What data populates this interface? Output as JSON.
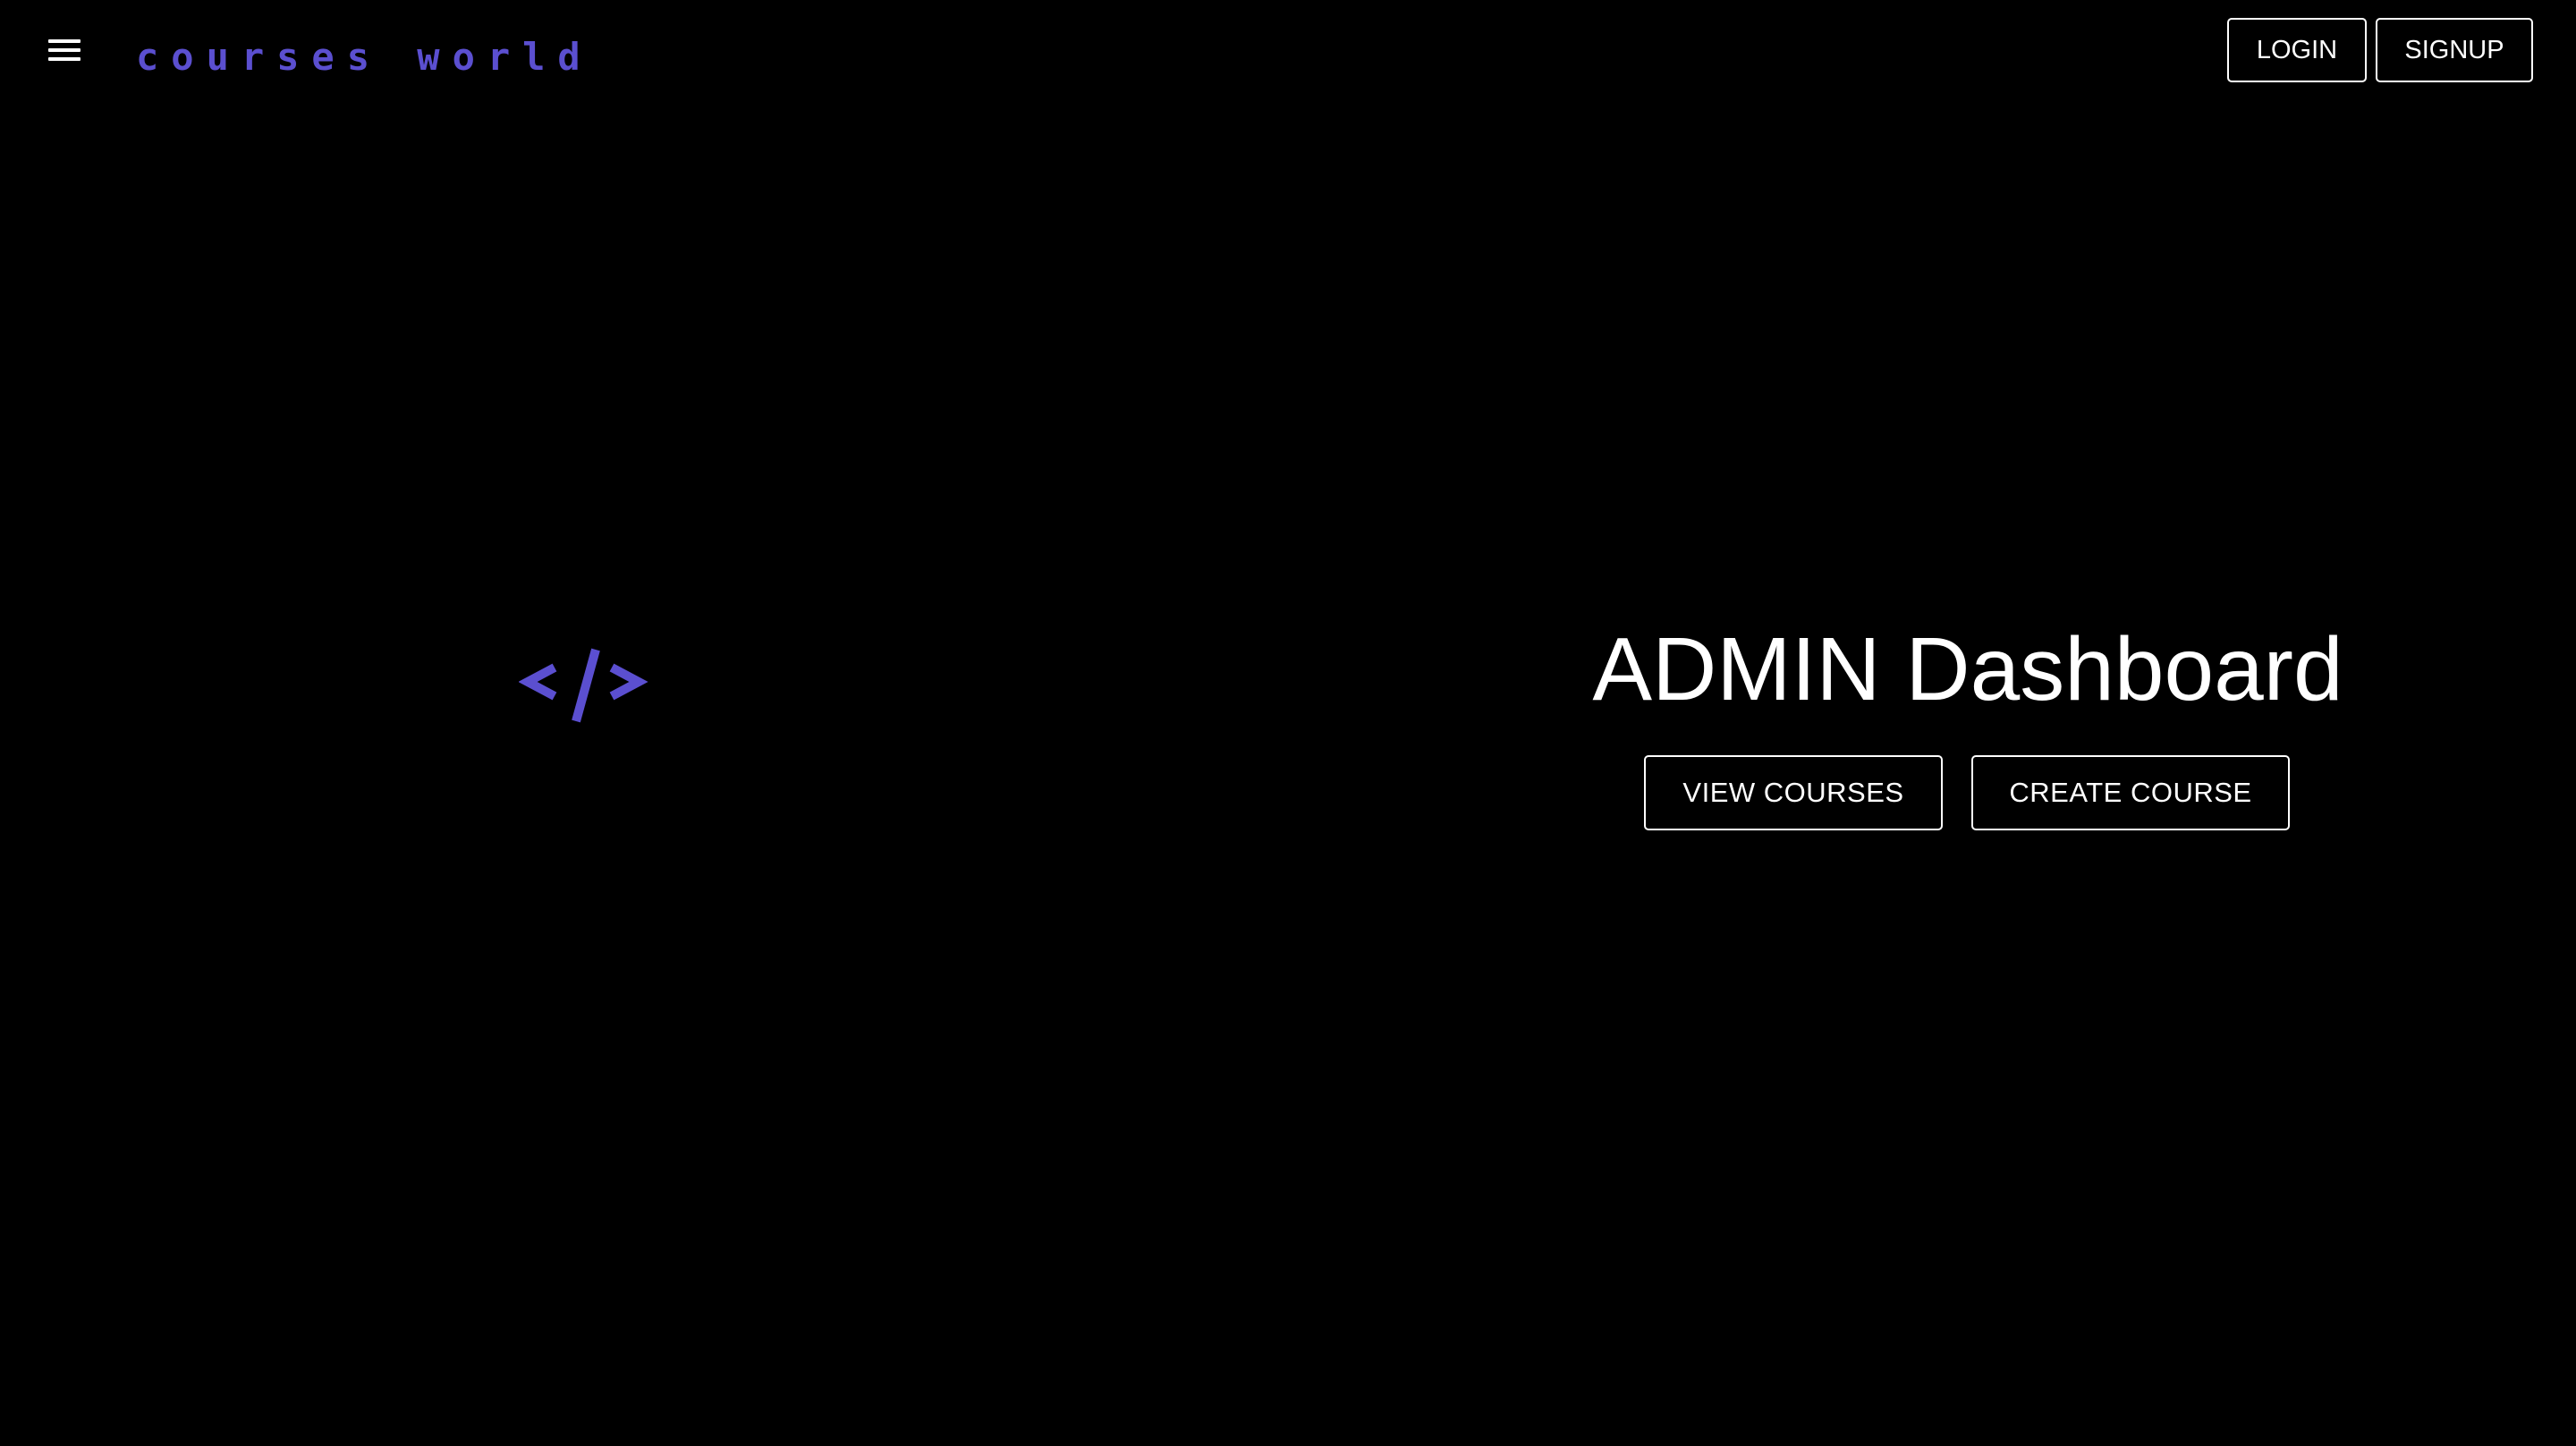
{
  "header": {
    "brand": "courses world",
    "login_label": "LOGIN",
    "signup_label": "SIGNUP"
  },
  "hero": {
    "logo_text": "</>",
    "title": "ADMIN Dashboard",
    "view_courses_label": "VIEW COURSES",
    "create_course_label": "CREATE COURSE"
  },
  "icons": {
    "menu": "hamburger-menu-icon",
    "logo": "code-brackets-icon"
  },
  "colors": {
    "background": "#000000",
    "brand": "#5b4fd0",
    "text": "#ffffff",
    "button_border": "#ffffff"
  }
}
